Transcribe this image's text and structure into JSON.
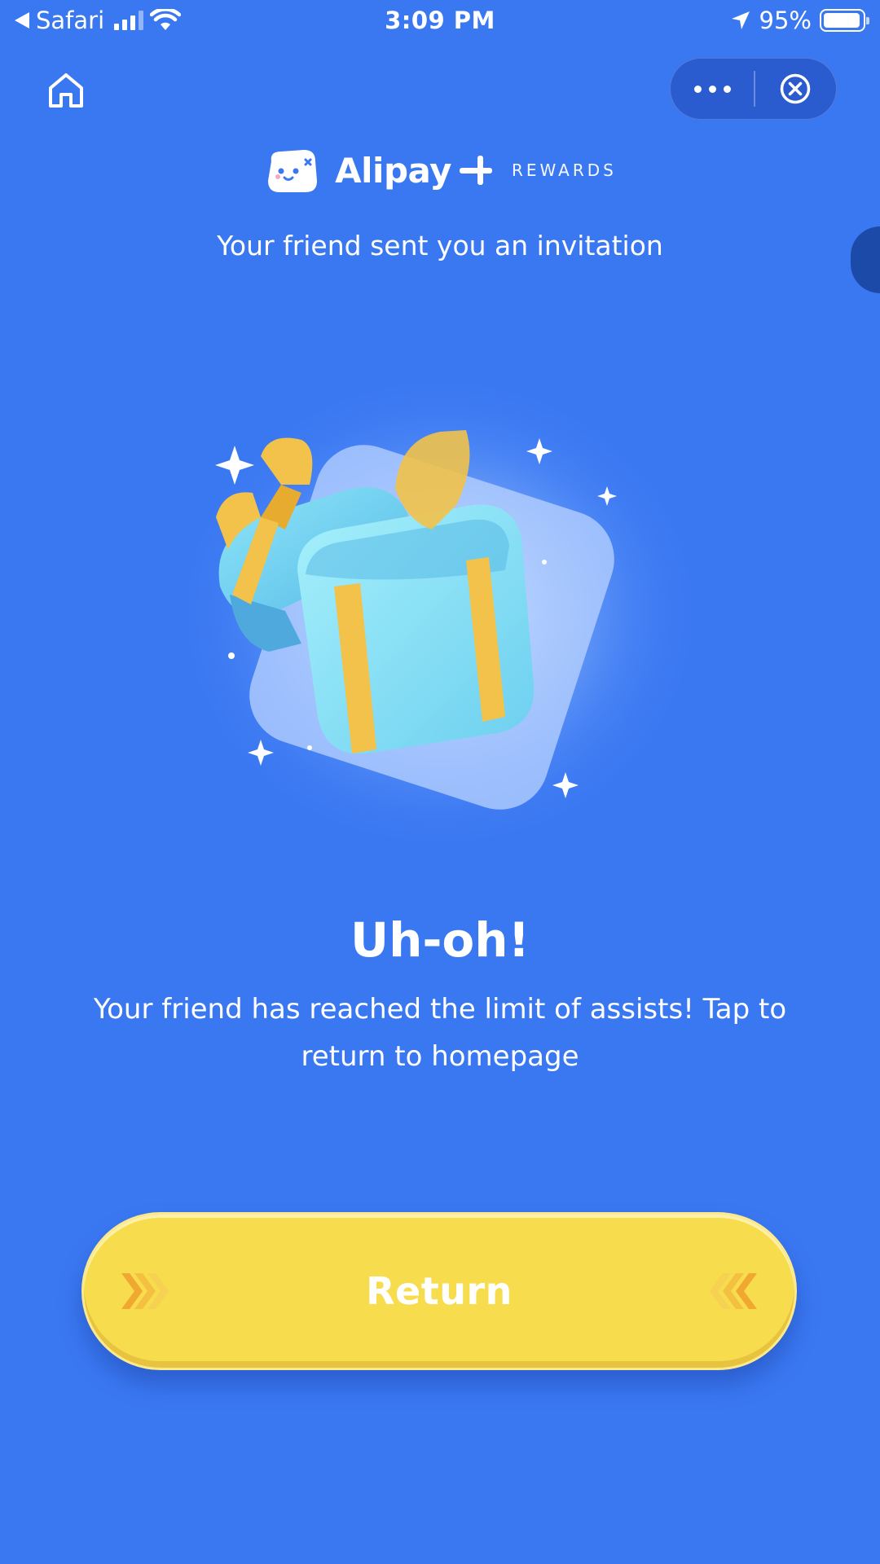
{
  "status_bar": {
    "back_app": "Safari",
    "time": "3:09 PM",
    "battery": "95%",
    "battery_level": 0.95
  },
  "brand": {
    "name": "Alipay",
    "tagline": "REWARDS"
  },
  "header": {
    "subtitle": "Your friend sent you an invitation"
  },
  "result": {
    "title": "Uh-oh!",
    "message": "Your friend has reached the limit of assists! Tap to return to homepage"
  },
  "actions": {
    "return_label": "Return"
  },
  "icons": {
    "home": "home-icon",
    "more": "more-dots-icon",
    "close": "close-circle-icon",
    "back": "back-arrow-icon",
    "location": "location-arrow-icon",
    "wifi": "wifi-icon",
    "signal": "signal-icon",
    "battery": "battery-icon"
  },
  "colors": {
    "background": "#3a78f2",
    "button": "#f7dc4e",
    "gift": "#8de6f8",
    "ribbon": "#f2c24a"
  }
}
